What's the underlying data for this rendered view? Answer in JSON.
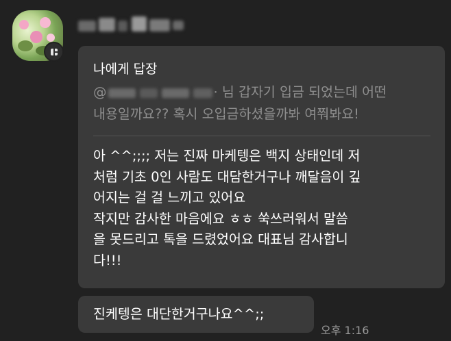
{
  "chat": {
    "sender": {
      "name_obscured": true,
      "avatar_icon": "flower-photo-avatar",
      "badge_icon": "channel-badge-icon"
    },
    "messages": [
      {
        "type": "reply",
        "reply_title": "나에게 답장",
        "quoted_prefix": "@",
        "quoted_line1_rest": "· 님 갑자기 입금 되었는데 어떤",
        "quoted_line2": "내용일까요?? 혹시 오입금하셨을까봐 여쭤봐요!",
        "body_lines": [
          "아 ^^;;;; 저는 진짜 마케텡은 백지 상태인데 저",
          "처럼 기초 0인 사람도 대담한거구나 깨달음이 깊",
          "어지는 걸 걸 느끼고 있어요",
          "작지만 감사한 마음에요 ㅎㅎ  쑥쓰러워서  말씀",
          "을 못드리고 톡을 드렸었어요  대표님 감사합니",
          "다!!!"
        ]
      },
      {
        "type": "text",
        "text": "진케텡은 대단한거구나요^^;;",
        "time": "오후 1:16"
      }
    ]
  },
  "colors": {
    "background": "#212121",
    "bubble": "#3a3a3a",
    "text_primary": "#ffffff",
    "text_quoted": "#8e8e8e",
    "timestamp": "#9a9a9a"
  }
}
